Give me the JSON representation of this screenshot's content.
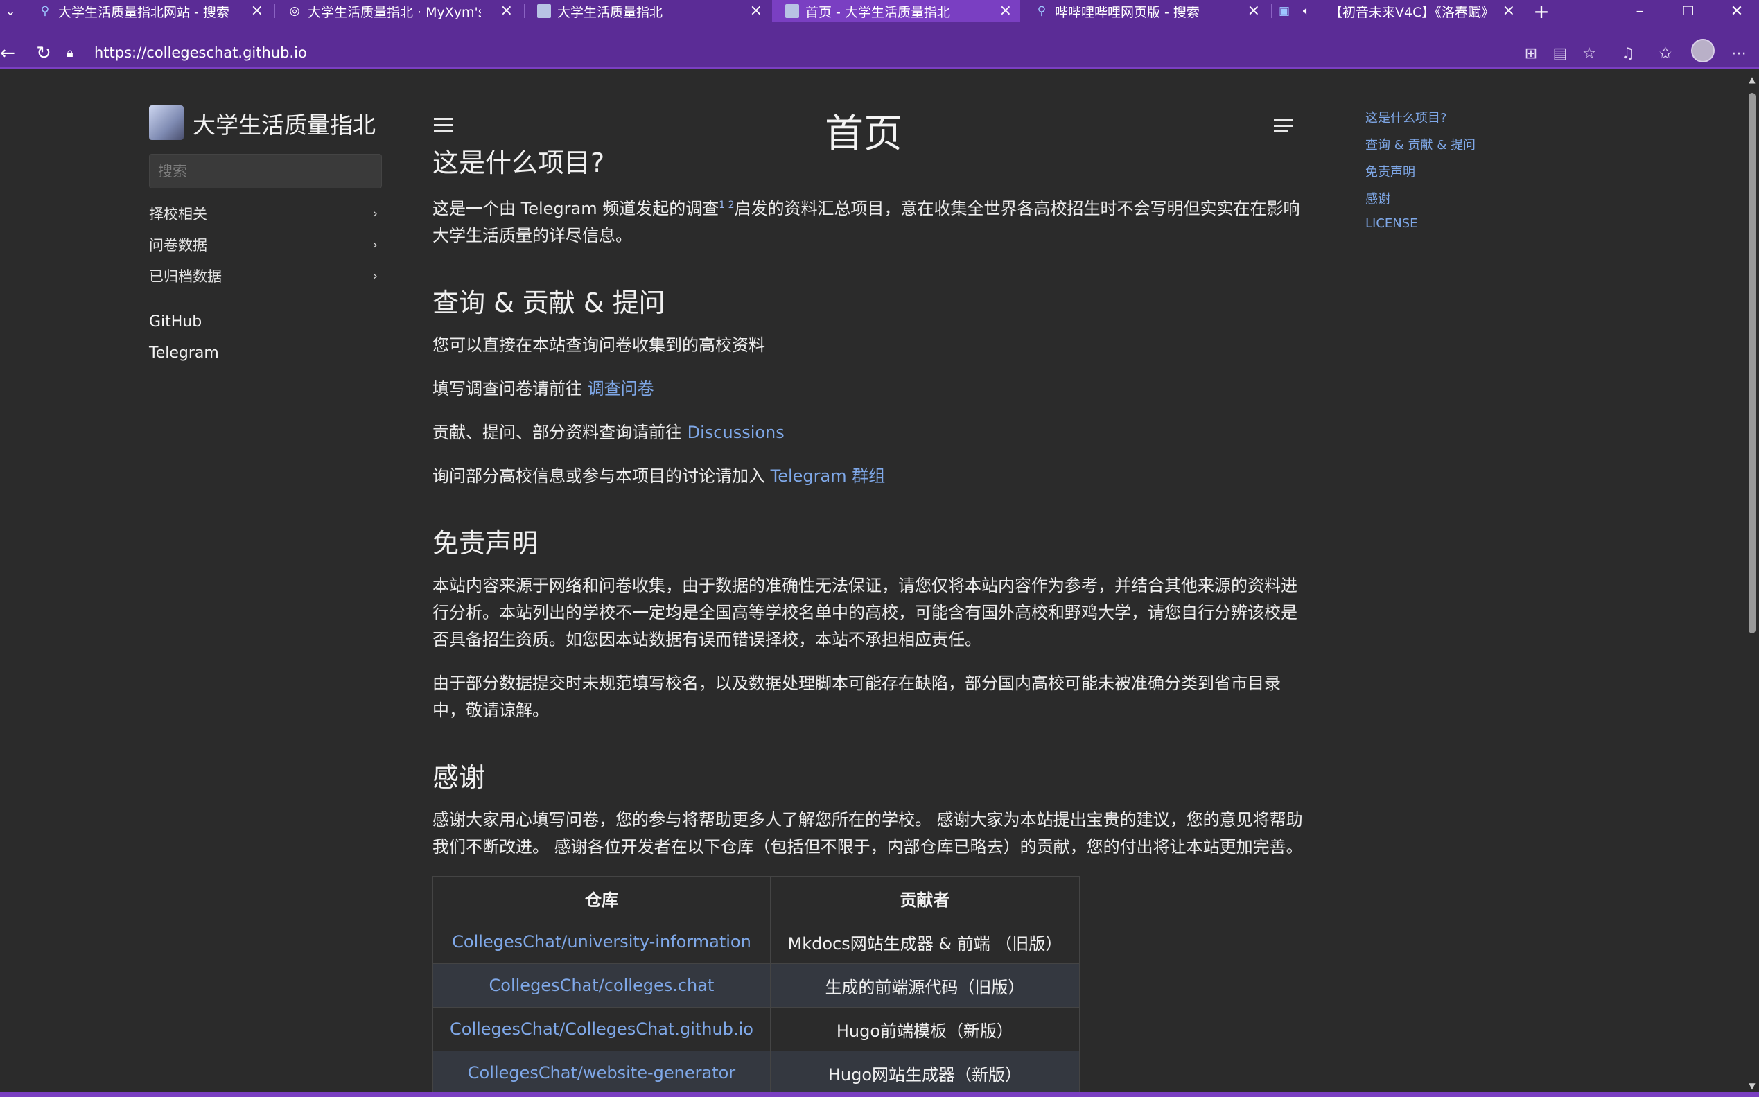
{
  "browser": {
    "tabs": [
      {
        "title": "大学生活质量指北网站 - 搜索",
        "icon": "search-icon"
      },
      {
        "title": "大学生活质量指北 · MyXym's Blog",
        "icon": "globe-icon"
      },
      {
        "title": "大学生活质量指北",
        "icon": "site-favicon"
      },
      {
        "title": "首页 - 大学生活质量指北",
        "icon": "site-favicon",
        "active": true
      },
      {
        "title": "哔哔哩哔哩网页版 - 搜索",
        "icon": "search-icon"
      },
      {
        "title": "【初音未来V4C】《洛春赋》",
        "icon": "bilibili-icon"
      }
    ],
    "url": "https://collegeschat.github.io"
  },
  "sidebar": {
    "site_title": "大学生活质量指北",
    "search_placeholder": "搜索",
    "sections": [
      "择校相关",
      "问卷数据",
      "已归档数据"
    ],
    "links": [
      "GitHub",
      "Telegram"
    ]
  },
  "main": {
    "page_title": "首页",
    "s1": {
      "heading": "这是什么项目?",
      "text_a": "这是一个由 Telegram 频道发起的调查",
      "sup": "1 2",
      "text_b": "启发的资料汇总项目，意在收集全世界各高校招生时不会写明但实实在在影响大学生活质量的详尽信息。"
    },
    "s2": {
      "heading": "查询 & 贡献 & 提问",
      "p1": "您可以直接在本站查询问卷收集到的高校资料",
      "p2_text": "填写调查问卷请前往",
      "p2_link": "调查问卷",
      "p3_text": "贡献、提问、部分资料查询请前往",
      "p3_link": "Discussions",
      "p4_text": "询问部分高校信息或参与本项目的讨论请加入",
      "p4_link": "Telegram 群组"
    },
    "s3": {
      "heading": "免责声明",
      "p1": "本站内容来源于网络和问卷收集，由于数据的准确性无法保证，请您仅将本站内容作为参考，并结合其他来源的资料进行分析。本站列出的学校不一定均是全国高等学校名单中的高校，可能含有国外高校和野鸡大学，请您自行分辨该校是否具备招生资质。如您因本站数据有误而错误择校，本站不承担相应责任。",
      "p2": "由于部分数据提交时未规范填写校名，以及数据处理脚本可能存在缺陷，部分国内高校可能未被准确分类到省市目录中，敬请谅解。"
    },
    "s4": {
      "heading": "感谢",
      "p1": "感谢大家用心填写问卷，您的参与将帮助更多人了解您所在的学校。 感谢大家为本站提出宝贵的建议，您的意见将帮助我们不断改进。 感谢各位开发者在以下仓库（包括但不限于，内部仓库已略去）的贡献，您的付出将让本站更加完善。",
      "table_headers": [
        "仓库",
        "贡献者"
      ],
      "rows": [
        {
          "repo": "CollegesChat/university-information",
          "contrib": "Mkdocs网站生成器 & 前端 （旧版）"
        },
        {
          "repo": "CollegesChat/colleges.chat",
          "contrib": "生成的前端源代码（旧版）"
        },
        {
          "repo": "CollegesChat/CollegesChat.github.io",
          "contrib": "Hugo前端模板（新版）"
        },
        {
          "repo": "CollegesChat/website-generator",
          "contrib": "Hugo网站生成器（新版）"
        }
      ]
    }
  },
  "toc": [
    "这是什么项目?",
    "查询 & 贡献 & 提问",
    "免责声明",
    "感谢",
    "LICENSE"
  ],
  "colors": {
    "chrome": "#5b2c96",
    "active_tab": "#7a3fc2",
    "link": "#7fa8e8",
    "background": "#2b2b2b"
  }
}
